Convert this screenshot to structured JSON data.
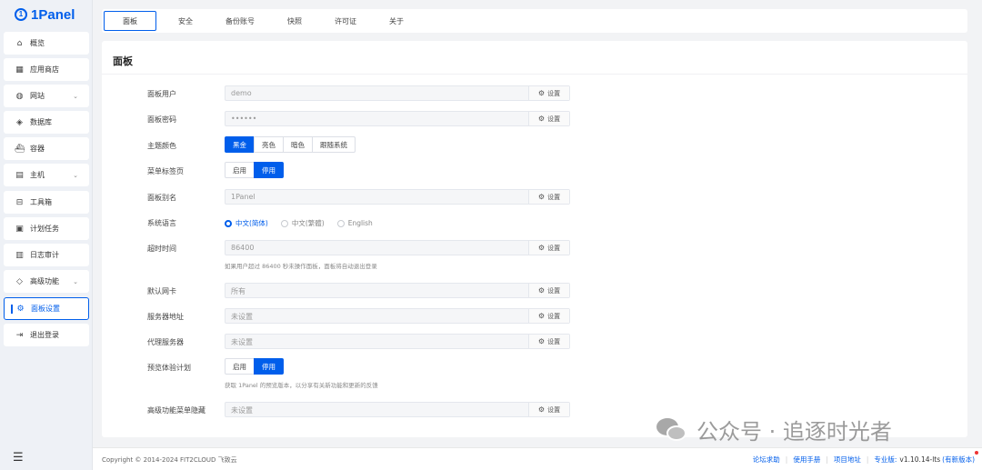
{
  "app": {
    "logo_text": "1Panel"
  },
  "sidebar": {
    "items": [
      {
        "label": "概览",
        "icon": "home-icon"
      },
      {
        "label": "应用商店",
        "icon": "grid-icon"
      },
      {
        "label": "网站",
        "icon": "globe-icon",
        "expandable": true
      },
      {
        "label": "数据库",
        "icon": "database-icon"
      },
      {
        "label": "容器",
        "icon": "container-icon"
      },
      {
        "label": "主机",
        "icon": "server-icon",
        "expandable": true
      },
      {
        "label": "工具箱",
        "icon": "toolbox-icon"
      },
      {
        "label": "计划任务",
        "icon": "calendar-icon"
      },
      {
        "label": "日志审计",
        "icon": "log-icon"
      },
      {
        "label": "高级功能",
        "icon": "diamond-icon",
        "expandable": true
      },
      {
        "label": "面板设置",
        "icon": "gear-icon",
        "active": true
      },
      {
        "label": "退出登录",
        "icon": "logout-icon"
      }
    ]
  },
  "tabs": [
    {
      "label": "面板",
      "active": true
    },
    {
      "label": "安全"
    },
    {
      "label": "备份账号"
    },
    {
      "label": "快照"
    },
    {
      "label": "许可证"
    },
    {
      "label": "关于"
    }
  ],
  "panel": {
    "title": "面板",
    "settings_btn": "设置",
    "fields": {
      "user": {
        "label": "面板用户",
        "value": "demo"
      },
      "password": {
        "label": "面板密码",
        "value": "••••••"
      },
      "theme": {
        "label": "主题颜色",
        "options": [
          "黑金",
          "亮色",
          "暗色",
          "跟随系统"
        ],
        "selected": "黑金"
      },
      "menu_tabs": {
        "label": "菜单标签页",
        "options": [
          "启用",
          "停用"
        ],
        "selected": "停用"
      },
      "alias": {
        "label": "面板别名",
        "value": "1Panel"
      },
      "language": {
        "label": "系统语言",
        "options": [
          "中文(简体)",
          "中文(繁體)",
          "English"
        ],
        "selected": "中文(简体)"
      },
      "timeout": {
        "label": "超时时间",
        "value": "86400",
        "hint": "如果用户超过 86400 秒未操作面板，面板将自动退出登录"
      },
      "nic": {
        "label": "默认网卡",
        "value": "所有"
      },
      "server_addr": {
        "label": "服务器地址",
        "value": "未设置"
      },
      "proxy": {
        "label": "代理服务器",
        "value": "未设置"
      },
      "preview": {
        "label": "预览体验计划",
        "options": [
          "启用",
          "停用"
        ],
        "selected": "停用",
        "hint": "获取 1Panel 的预览版本，以分享有关新功能和更新的反馈"
      },
      "hide_menu": {
        "label": "高级功能菜单隐藏",
        "value": "未设置"
      }
    }
  },
  "footer": {
    "copyright": "Copyright © 2014-2024 FIT2CLOUD 飞致云",
    "links": [
      "论坛求助",
      "使用手册",
      "项目地址"
    ],
    "edition": "专业版:",
    "version": "v1.10.14-lts",
    "update": "(有新版本)"
  },
  "watermark": {
    "text": "公众号 · 追逐时光者"
  },
  "colors": {
    "primary": "#005eeb",
    "background": "#f2f3f5",
    "sidebar": "#eef1f6"
  }
}
